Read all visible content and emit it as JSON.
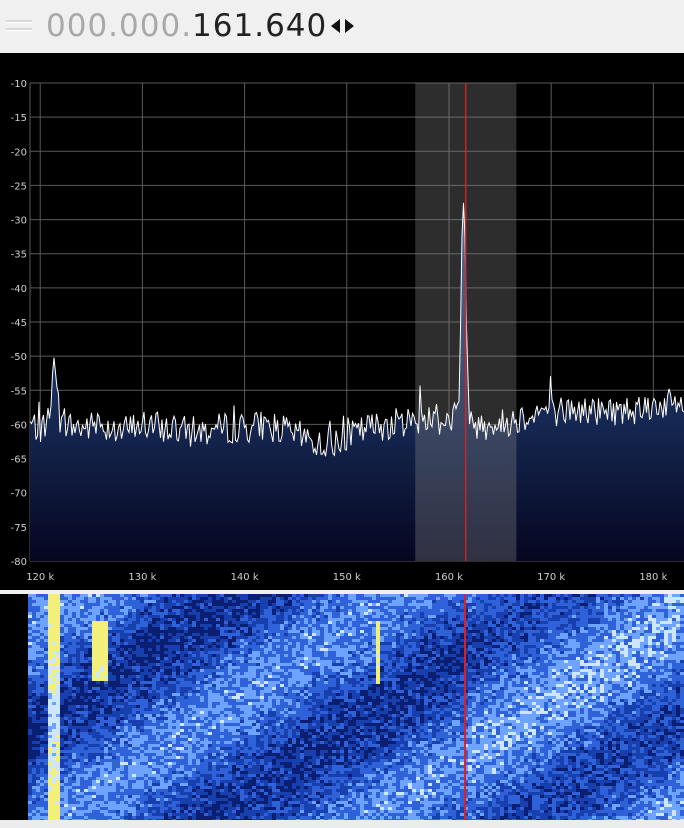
{
  "frequency": {
    "dim_part": "000.000.",
    "bright_part": "161.640"
  },
  "colors": {
    "grid": "#5a5a5a",
    "trace": "#ffffff",
    "fill_top": "#2f5b9e",
    "fill_bottom": "#050620",
    "passband": "#888888",
    "marker": "#e02020",
    "axis_text": "#cccccc"
  },
  "chart_data": {
    "type": "line",
    "title": "",
    "xlabel": "",
    "ylabel": "",
    "x_unit": "Hz",
    "xlim": [
      119000,
      183000
    ],
    "ylim": [
      -80,
      -10
    ],
    "y_ticks": [
      -10,
      -15,
      -20,
      -25,
      -30,
      -35,
      -40,
      -45,
      -50,
      -55,
      -60,
      -65,
      -70,
      -75,
      -80
    ],
    "x_ticks": [
      120000,
      130000,
      140000,
      150000,
      160000,
      170000,
      180000
    ],
    "x_tick_labels": [
      "120 k",
      "130 k",
      "140 k",
      "150 k",
      "160 k",
      "170 k",
      "180 k"
    ],
    "grid": true,
    "passband": [
      156700,
      166600
    ],
    "marker_frequency": 161640,
    "peaks": [
      {
        "x": 121300,
        "y": -49.5
      },
      {
        "x": 161500,
        "y": -26
      }
    ],
    "series": [
      {
        "x": [
          119000,
          120000,
          121000,
          121300,
          122000,
          124000,
          126000,
          128000,
          130000,
          132000,
          134000,
          136000,
          138000,
          140000,
          142000,
          144000,
          146000,
          147500,
          149000,
          150000,
          152000,
          154000,
          156000,
          158000,
          160000,
          161000,
          161300,
          161500,
          161700,
          162000,
          163000,
          165000,
          167000,
          169000,
          171000,
          173000,
          175000,
          177000,
          179000,
          181000,
          183000
        ],
        "y": [
          -60,
          -60.5,
          -59,
          -49.5,
          -60,
          -60.5,
          -60,
          -61,
          -60,
          -60.5,
          -61,
          -61,
          -60.5,
          -60.5,
          -60,
          -61,
          -62,
          -63,
          -62.5,
          -62,
          -60.5,
          -60,
          -59.5,
          -59,
          -59.5,
          -58,
          -30,
          -26,
          -45,
          -60,
          -60,
          -60,
          -59,
          -58,
          -58,
          -58,
          -58,
          -58,
          -57.5,
          -57,
          -57
        ]
      }
    ]
  }
}
